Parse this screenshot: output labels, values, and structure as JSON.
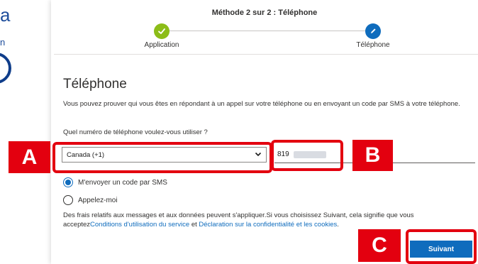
{
  "background": {
    "big_letter": "a",
    "small_letter": "n"
  },
  "header": {
    "step_title": "Méthode 2 sur 2 : Téléphone",
    "steps": [
      {
        "label": "Application",
        "status": "done",
        "icon": "checkmark-icon"
      },
      {
        "label": "Téléphone",
        "status": "current",
        "icon": "pencil-icon"
      }
    ]
  },
  "main": {
    "title": "Téléphone",
    "description": "Vous pouvez prouver qui vous êtes en répondant à un appel sur votre téléphone ou en envoyant un code par SMS à votre téléphone.",
    "question": "Quel numéro de téléphone voulez-vous utiliser ?",
    "country_select": {
      "selected": "Canada (+1)"
    },
    "phone_input": {
      "value": "819"
    },
    "radio_options": [
      {
        "label": "M'envoyer un code par SMS",
        "checked": true
      },
      {
        "label": "Appelez-moi",
        "checked": false
      }
    ],
    "notice": {
      "text_before": "Des frais relatifs aux messages et aux données peuvent s'appliquer.Si vous choisissez Suivant, cela signifie que vous acceptez",
      "link_terms": "Conditions d'utilisation du service",
      "text_middle": " et ",
      "link_privacy": "Déclaration sur la confidentialité et les cookies",
      "text_after": "."
    },
    "next_button": "Suivant"
  },
  "callouts": {
    "a": "A",
    "b": "B",
    "c": "C"
  },
  "colors": {
    "accent": "#0f6cbd",
    "done": "#8cbd18",
    "callout": "#e3000f"
  }
}
